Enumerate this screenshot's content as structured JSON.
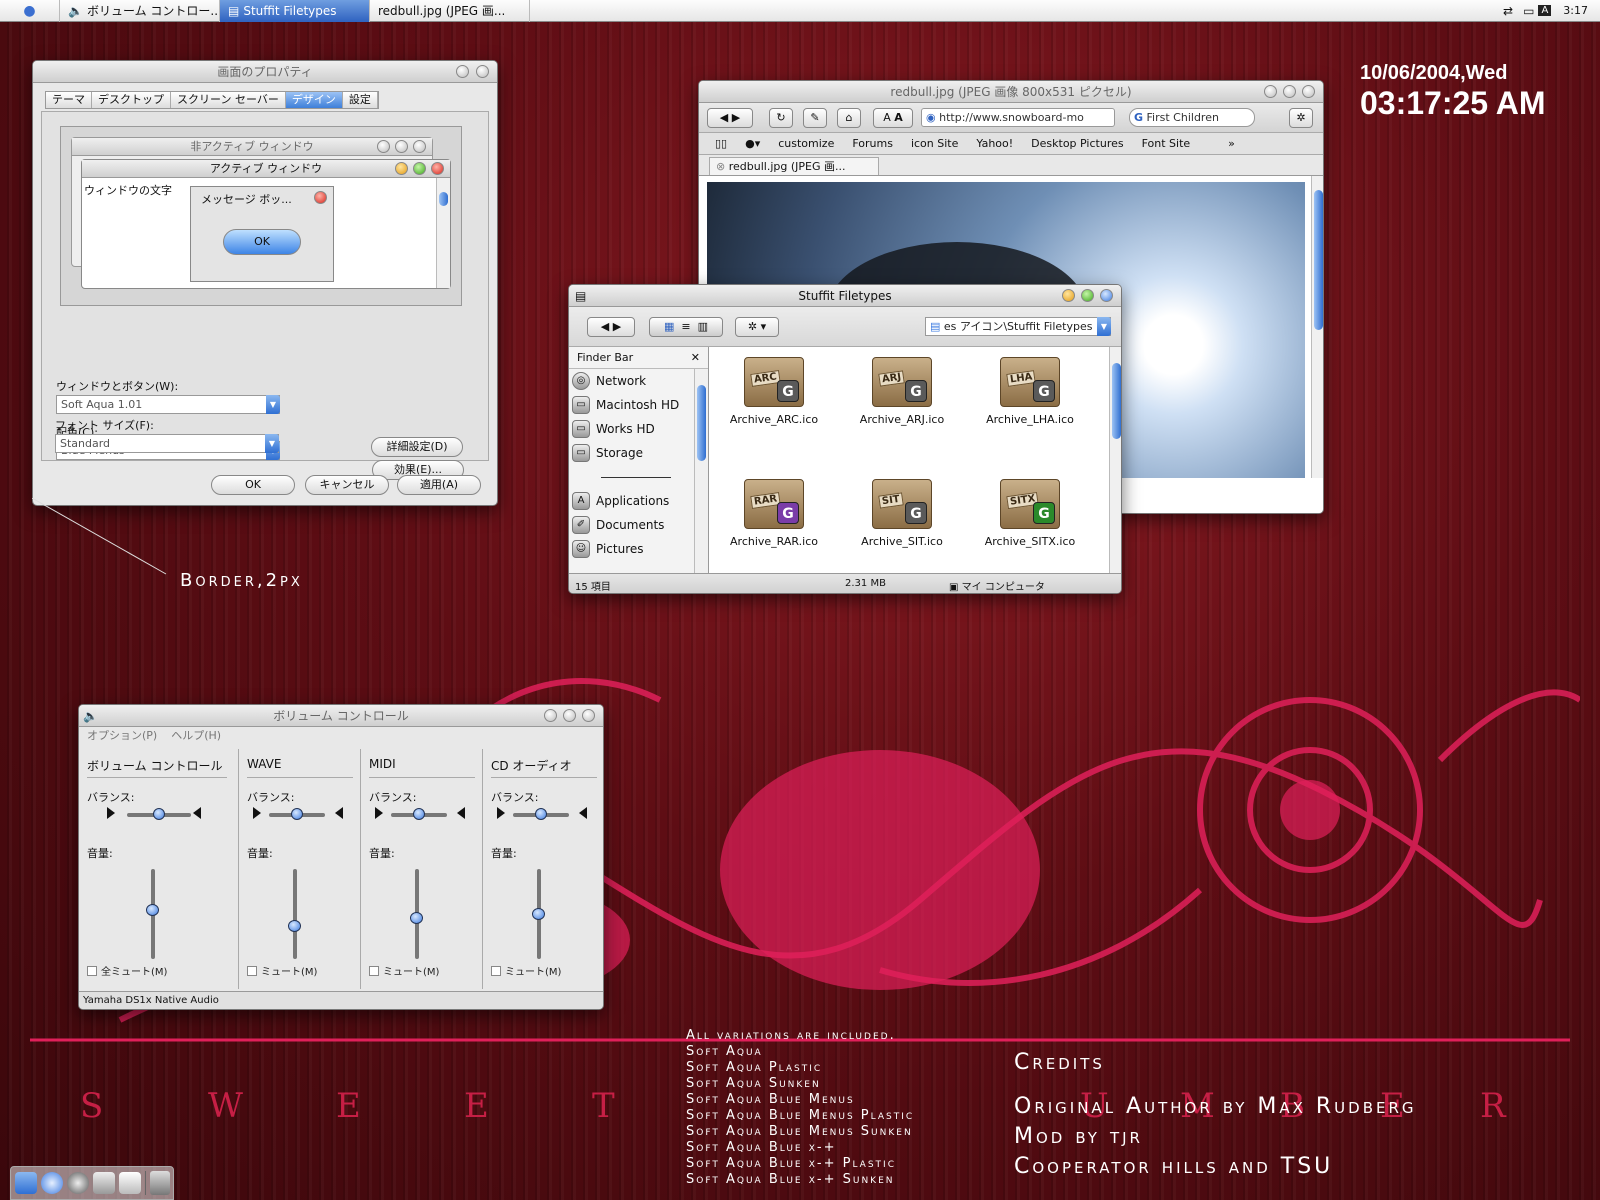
{
  "menubar": {
    "tasks": [
      "ボリューム コントロー...",
      "Stuffit Filetypes",
      "redbull.jpg (JPEG 画..."
    ],
    "time": "3:17"
  },
  "clock": {
    "date": "10/06/2004,Wed",
    "time": "03:17:25 AM"
  },
  "display_props": {
    "title": "画面のプロパティ",
    "tabs": [
      "テーマ",
      "デスクトップ",
      "スクリーン セーバー",
      "デザイン",
      "設定"
    ],
    "inactive_title": "非アクティブ ウィンドウ",
    "active_title": "アクティブ ウィンドウ",
    "window_text": "ウィンドウの文字",
    "message_title": "メッセージ ボッ...",
    "ok_label": "OK",
    "label_windows_buttons": "ウィンドウとボタン(W):",
    "value_windows_buttons": "Soft Aqua 1.01",
    "label_color": "配色(C):",
    "value_color": "Blue Menus",
    "label_font": "フォント サイズ(F):",
    "value_font": "Standard",
    "effects_button": "効果(E)...",
    "advanced_button": "詳細設定(D)",
    "ok_button": "OK",
    "cancel_button": "キャンセル",
    "apply_button": "適用(A)"
  },
  "annotation": {
    "border_label": "Border,2px"
  },
  "browser": {
    "title": "redbull.jpg (JPEG 画像 800x531 ピクセル)",
    "url": "http://www.snowboard-mo",
    "search": "First Children",
    "bookmarks": [
      "customize",
      "Forums",
      "icon Site",
      "Yahoo!",
      "Desktop Pictures",
      "Font Site"
    ],
    "tab": "redbull.jpg (JPEG 画..."
  },
  "finder": {
    "title": "Stuffit Filetypes",
    "path": "es アイコン\\Stuffit Filetypes",
    "sidebar_title": "Finder Bar",
    "sidebar_items": [
      "Network",
      "Macintosh HD",
      "Works HD",
      "Storage",
      "Applications",
      "Documents",
      "Pictures"
    ],
    "files": [
      {
        "name": "Archive_ARC.ico",
        "tag": "ARC",
        "color": "#5a5a5a"
      },
      {
        "name": "Archive_ARJ.ico",
        "tag": "ARJ",
        "color": "#5a5a5a"
      },
      {
        "name": "Archive_LHA.ico",
        "tag": "LHA",
        "color": "#5a5a5a"
      },
      {
        "name": "Archive_RAR.ico",
        "tag": "RAR",
        "color": "#7a3ca8"
      },
      {
        "name": "Archive_SIT.ico",
        "tag": "SIT",
        "color": "#5a5a5a"
      },
      {
        "name": "Archive_SITX.ico",
        "tag": "SITX",
        "color": "#2b8a2b"
      }
    ],
    "status_count": "15 項目",
    "status_size": "2.31 MB",
    "status_location": "マイ コンピュータ"
  },
  "volume": {
    "title": "ボリューム コントロール",
    "menu": [
      "オプション(P)",
      "ヘルプ(H)"
    ],
    "columns": [
      {
        "title": "ボリューム コントロール",
        "balance": "バランス:",
        "volume": "音量:",
        "mute": "全ミュート(M)",
        "level": 0.55
      },
      {
        "title": "WAVE",
        "balance": "バランス:",
        "volume": "音量:",
        "mute": "ミュート(M)",
        "level": 0.35
      },
      {
        "title": "MIDI",
        "balance": "バランス:",
        "volume": "音量:",
        "mute": "ミュート(M)",
        "level": 0.45
      },
      {
        "title": "CD オーディオ",
        "balance": "バランス:",
        "volume": "音量:",
        "mute": "ミュート(M)",
        "level": 0.5
      }
    ],
    "device": "Yamaha DS1x Native Audio"
  },
  "variations": [
    "All variations are included.",
    "Soft Aqua",
    "Soft Aqua Plastic",
    "Soft Aqua Sunken",
    "Soft Aqua Blue Menus",
    "Soft Aqua Blue Menus Plastic",
    "Soft Aqua Blue Menus Sunken",
    "Soft Aqua Blue x-+",
    "Soft Aqua Blue x-+ Plastic",
    "Soft Aqua Blue x-+ Sunken"
  ],
  "credits": {
    "heading": "Credits",
    "lines": [
      "Original Author by Max Rudberg",
      "Mod by tjr",
      "Cooperator hills and TSU"
    ]
  },
  "wallpaper_letters": [
    "S",
    "W",
    "E",
    "E",
    "T",
    "U",
    "M",
    "B",
    "E",
    "R"
  ],
  "colors": {
    "accent": "#3d7be0",
    "wallpaper": "#6b0f17",
    "ornament": "#e0205a"
  }
}
